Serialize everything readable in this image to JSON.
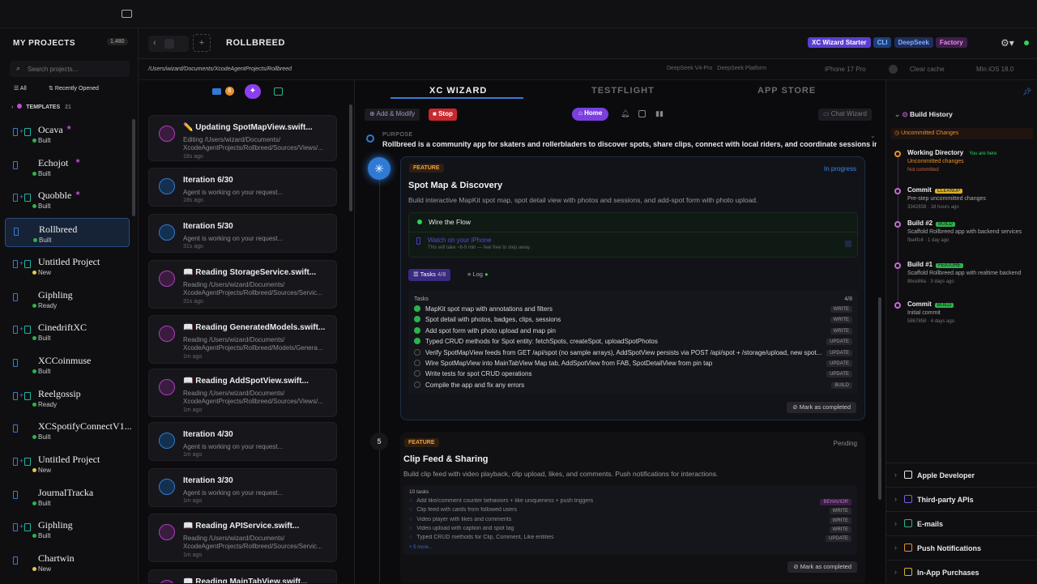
{
  "sidebar": {
    "title": "MY PROJECTS",
    "count": "1,480",
    "search_placeholder": "Search projects...",
    "filter_all": "All",
    "filter_recent": "Recently Opened",
    "templates": "TEMPLATES",
    "templates_count": "21",
    "projects": [
      {
        "name": "Ocava",
        "status": "Built",
        "dot": "#2bb44a",
        "star": "★"
      },
      {
        "name": "Echojot",
        "status": "Built",
        "dot": "#2bb44a",
        "star": "★"
      },
      {
        "name": "Quobble",
        "status": "Built",
        "dot": "#2bb44a",
        "star": "★"
      },
      {
        "name": "Rollbreed",
        "status": "Built",
        "dot": "#2bb44a",
        "star": ""
      },
      {
        "name": "Untitled Project",
        "status": "New",
        "dot": "#e8c547",
        "star": ""
      },
      {
        "name": "Giphling",
        "status": "Ready",
        "dot": "#2bb44a",
        "star": ""
      },
      {
        "name": "CinedriftXC",
        "status": "Built",
        "dot": "#2bb44a",
        "star": ""
      },
      {
        "name": "XCCoinmuse",
        "status": "Built",
        "dot": "#2bb44a",
        "star": ""
      },
      {
        "name": "Reelgossip",
        "status": "Ready",
        "dot": "#2bb44a",
        "star": ""
      },
      {
        "name": "XCSpotifyConnectV1...",
        "status": "Built",
        "dot": "#2bb44a",
        "star": ""
      },
      {
        "name": "Untitled Project",
        "status": "New",
        "dot": "#e8c547",
        "star": ""
      },
      {
        "name": "JournalTracka",
        "status": "Built",
        "dot": "#2bb44a",
        "star": ""
      },
      {
        "name": "Giphling",
        "status": "Built",
        "dot": "#2bb44a",
        "star": ""
      },
      {
        "name": "Chartwin",
        "status": "New",
        "dot": "#e8c547",
        "star": ""
      }
    ]
  },
  "header": {
    "project_name": "ROLLBREED",
    "badges": [
      "XC Wizard Starter",
      "CLI",
      "DeepSeek",
      "Factory"
    ]
  },
  "pathbar": {
    "path": "/Users/wizard/Documents/XcodeAgentProjects/Rollbreed",
    "model": "DeepSeek V4-Pro",
    "platform": "DeepSeek Platform",
    "device": "iPhone 17 Pro",
    "clear": "Clear cache",
    "min_ios": "Min iOS 18.0"
  },
  "feed": {
    "badge_count": "6",
    "cards": [
      {
        "title": "✏️ Updating SpotMapView.swift...",
        "sub": "Editing /Users/wizard/Documents/ XcodeAgentProjects/Rollbreed/Sources/Views/...",
        "time": "18s ago",
        "kind": "pink"
      },
      {
        "title": "Iteration 6/30",
        "sub": "Agent is working on your request...",
        "time": "18s ago",
        "kind": "blue"
      },
      {
        "title": "Iteration 5/30",
        "sub": "Agent is working on your request...",
        "time": "31s ago",
        "kind": "blue"
      },
      {
        "title": "📖 Reading StorageService.swift...",
        "sub": "Reading /Users/wizard/Documents/ XcodeAgentProjects/Rollbreed/Sources/Servic...",
        "time": "31s ago",
        "kind": "pink"
      },
      {
        "title": "📖 Reading GeneratedModels.swift...",
        "sub": "Reading /Users/wizard/Documents/ XcodeAgentProjects/Rollbreed/Models/Genera...",
        "time": "1m ago",
        "kind": "pink"
      },
      {
        "title": "📖 Reading AddSpotView.swift...",
        "sub": "Reading /Users/wizard/Documents/ XcodeAgentProjects/Rollbreed/Sources/Views/...",
        "time": "1m ago",
        "kind": "pink"
      },
      {
        "title": "Iteration 4/30",
        "sub": "Agent is working on your request...",
        "time": "1m ago",
        "kind": "blue"
      },
      {
        "title": "Iteration 3/30",
        "sub": "Agent is working on your request...",
        "time": "1m ago",
        "kind": "blue"
      },
      {
        "title": "📖 Reading APIService.swift...",
        "sub": "Reading /Users/wizard/Documents/ XcodeAgentProjects/Rollbreed/Sources/Servic...",
        "time": "1m ago",
        "kind": "pink"
      },
      {
        "title": "📖 Reading MainTabView.swift...",
        "sub": "",
        "time": "",
        "kind": "pink"
      }
    ]
  },
  "tabs": {
    "wizard": "XC WIZARD",
    "testflight": "TESTFLIGHT",
    "appstore": "APP STORE"
  },
  "toolbar": {
    "add_modify": "Add & Modify",
    "stop": "Stop",
    "home": "Home",
    "chat_wizard": "Chat Wizard"
  },
  "purpose": {
    "label": "PURPOSE",
    "text": "Rollbreed is a community app for skaters and rollerbladers to discover spots, share clips, connect with local riders, and coordinate sessions in r..."
  },
  "feature1": {
    "tag": "FEATURE",
    "status": "In progress",
    "title": "Spot Map & Discovery",
    "desc": "Build interactive MapKit spot map, spot detail view with photos and sessions, and add-spot form with photo upload.",
    "flow": "Wire the Flow",
    "watch": "Watch on your iPhone",
    "watch_sub": "This will take ~6-9 min — feel free to step away.",
    "tasks_tab": "Tasks",
    "tasks_count": "4/8",
    "log_tab": "Log",
    "tasks_label": "Tasks",
    "tasks_ratio": "4/8",
    "tasks": [
      {
        "t": "MapKit spot map with annotations and filters",
        "tag": "WRITE",
        "done": true
      },
      {
        "t": "Spot detail with photos, badges, clips, sessions",
        "tag": "WRITE",
        "done": true
      },
      {
        "t": "Add spot form with photo upload and map pin",
        "tag": "WRITE",
        "done": true
      },
      {
        "t": "Typed CRUD methods for Spot entity: fetchSpots, createSpot, uploadSpotPhotos",
        "tag": "UPDATE",
        "done": true
      },
      {
        "t": "Verify SpotMapView feeds from GET /api/spot (no sample arrays), AddSpotView persists via POST /api/spot + /storage/upload, new spot...",
        "tag": "UPDATE",
        "done": false
      },
      {
        "t": "Wire SpotMapView into MainTabView Map tab, AddSpotView from FAB, SpotDetailView from pin tap",
        "tag": "UPDATE",
        "done": false
      },
      {
        "t": "Write tests for spot CRUD operations",
        "tag": "UPDATE",
        "done": false
      },
      {
        "t": "Compile the app and fix any errors",
        "tag": "BUILD",
        "done": false
      }
    ],
    "mark": "Mark as completed"
  },
  "feature2": {
    "num": "5",
    "tag": "FEATURE",
    "status": "Pending",
    "title": "Clip Feed & Sharing",
    "desc": "Build clip feed with video playback, clip upload, likes, and comments. Push notifications for interactions.",
    "count": "10 tasks",
    "tasks": [
      {
        "t": "Add like/comment counter behaviors + like uniqueness + push triggers",
        "tag": "BEHAVIOR"
      },
      {
        "t": "Clip feed with cards from followed users",
        "tag": "WRITE"
      },
      {
        "t": "Video player with likes and comments",
        "tag": "WRITE"
      },
      {
        "t": "Video upload with caption and spot tag",
        "tag": "WRITE"
      },
      {
        "t": "Typed CRUD methods for Clip, Comment, Like entities",
        "tag": "UPDATE"
      }
    ],
    "more": "+ 5 more...",
    "mark": "Mark as completed"
  },
  "history": {
    "title": "Build History",
    "uncommitted": "Uncommitted Changes",
    "items": [
      {
        "title": "Working Directory",
        "tag": "You are here",
        "l1": "Uncommitted changes",
        "l2": "Not committed"
      },
      {
        "title": "Commit",
        "tag": "CLEANUP",
        "l1": "Pre-step uncommitted changes",
        "l2": "3342838 · 18 hours ago"
      },
      {
        "title": "Build #2",
        "tag": "BUILD",
        "l1": "Scaffold Rollbreed app with backend services",
        "l2": "fba4fc4 · 1 day ago"
      },
      {
        "title": "Build #1",
        "tag": "FEATURE",
        "l1": "Scaffold Rollbreed app with realtime backend",
        "l2": "8bce86a · 3 days ago"
      },
      {
        "title": "Commit",
        "tag": "BUILD",
        "l1": "Initial commit",
        "l2": "5867858 · 4 days ago"
      }
    ],
    "sections": [
      "Apple Developer",
      "Third-party APIs",
      "E-mails",
      "Push Notifications",
      "In-App Purchases"
    ]
  }
}
